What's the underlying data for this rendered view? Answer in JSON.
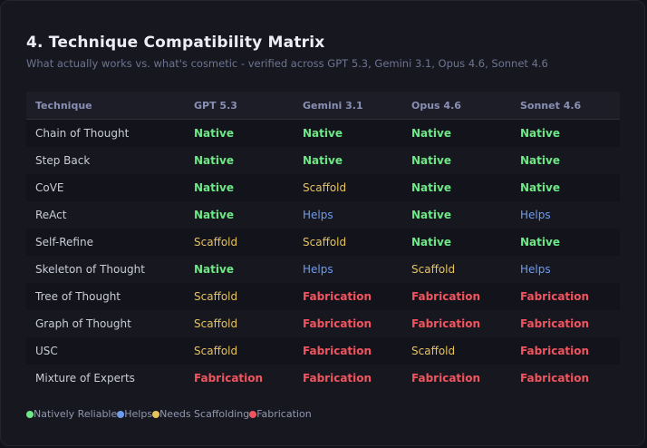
{
  "header": {
    "title": "4. Technique Compatibility Matrix",
    "subtitle": "What actually works vs. what's cosmetic - verified across GPT 5.3, Gemini 3.1, Opus 4.6, Sonnet 4.6"
  },
  "table": {
    "columns": [
      "Technique",
      "GPT 5.3",
      "Gemini 3.1",
      "Opus 4.6",
      "Sonnet 4.6"
    ],
    "rows": [
      [
        "Chain of Thought",
        "Native",
        "Native",
        "Native",
        "Native"
      ],
      [
        "Step Back",
        "Native",
        "Native",
        "Native",
        "Native"
      ],
      [
        "CoVE",
        "Native",
        "Scaffold",
        "Native",
        "Native"
      ],
      [
        "ReAct",
        "Native",
        "Helps",
        "Native",
        "Helps"
      ],
      [
        "Self-Refine",
        "Scaffold",
        "Scaffold",
        "Native",
        "Native"
      ],
      [
        "Skeleton of Thought",
        "Native",
        "Helps",
        "Scaffold",
        "Helps"
      ],
      [
        "Tree of Thought",
        "Scaffold",
        "Fabrication",
        "Fabrication",
        "Fabrication"
      ],
      [
        "Graph of Thought",
        "Scaffold",
        "Fabrication",
        "Fabrication",
        "Fabrication"
      ],
      [
        "USC",
        "Scaffold",
        "Fabrication",
        "Scaffold",
        "Fabrication"
      ],
      [
        "Mixture of Experts",
        "Fabrication",
        "Fabrication",
        "Fabrication",
        "Fabrication"
      ]
    ]
  },
  "legend": [
    {
      "label": "Natively Reliable",
      "color": "#6ee787"
    },
    {
      "label": "Helps",
      "color": "#6f9bef"
    },
    {
      "label": "Needs Scaffolding",
      "color": "#e7c35c"
    },
    {
      "label": "Fabrication",
      "color": "#f0545f"
    }
  ],
  "colors": {
    "native": "#6ee787",
    "scaffold": "#e7c35c",
    "helps": "#6f9bef",
    "fabrication": "#f0545f"
  }
}
